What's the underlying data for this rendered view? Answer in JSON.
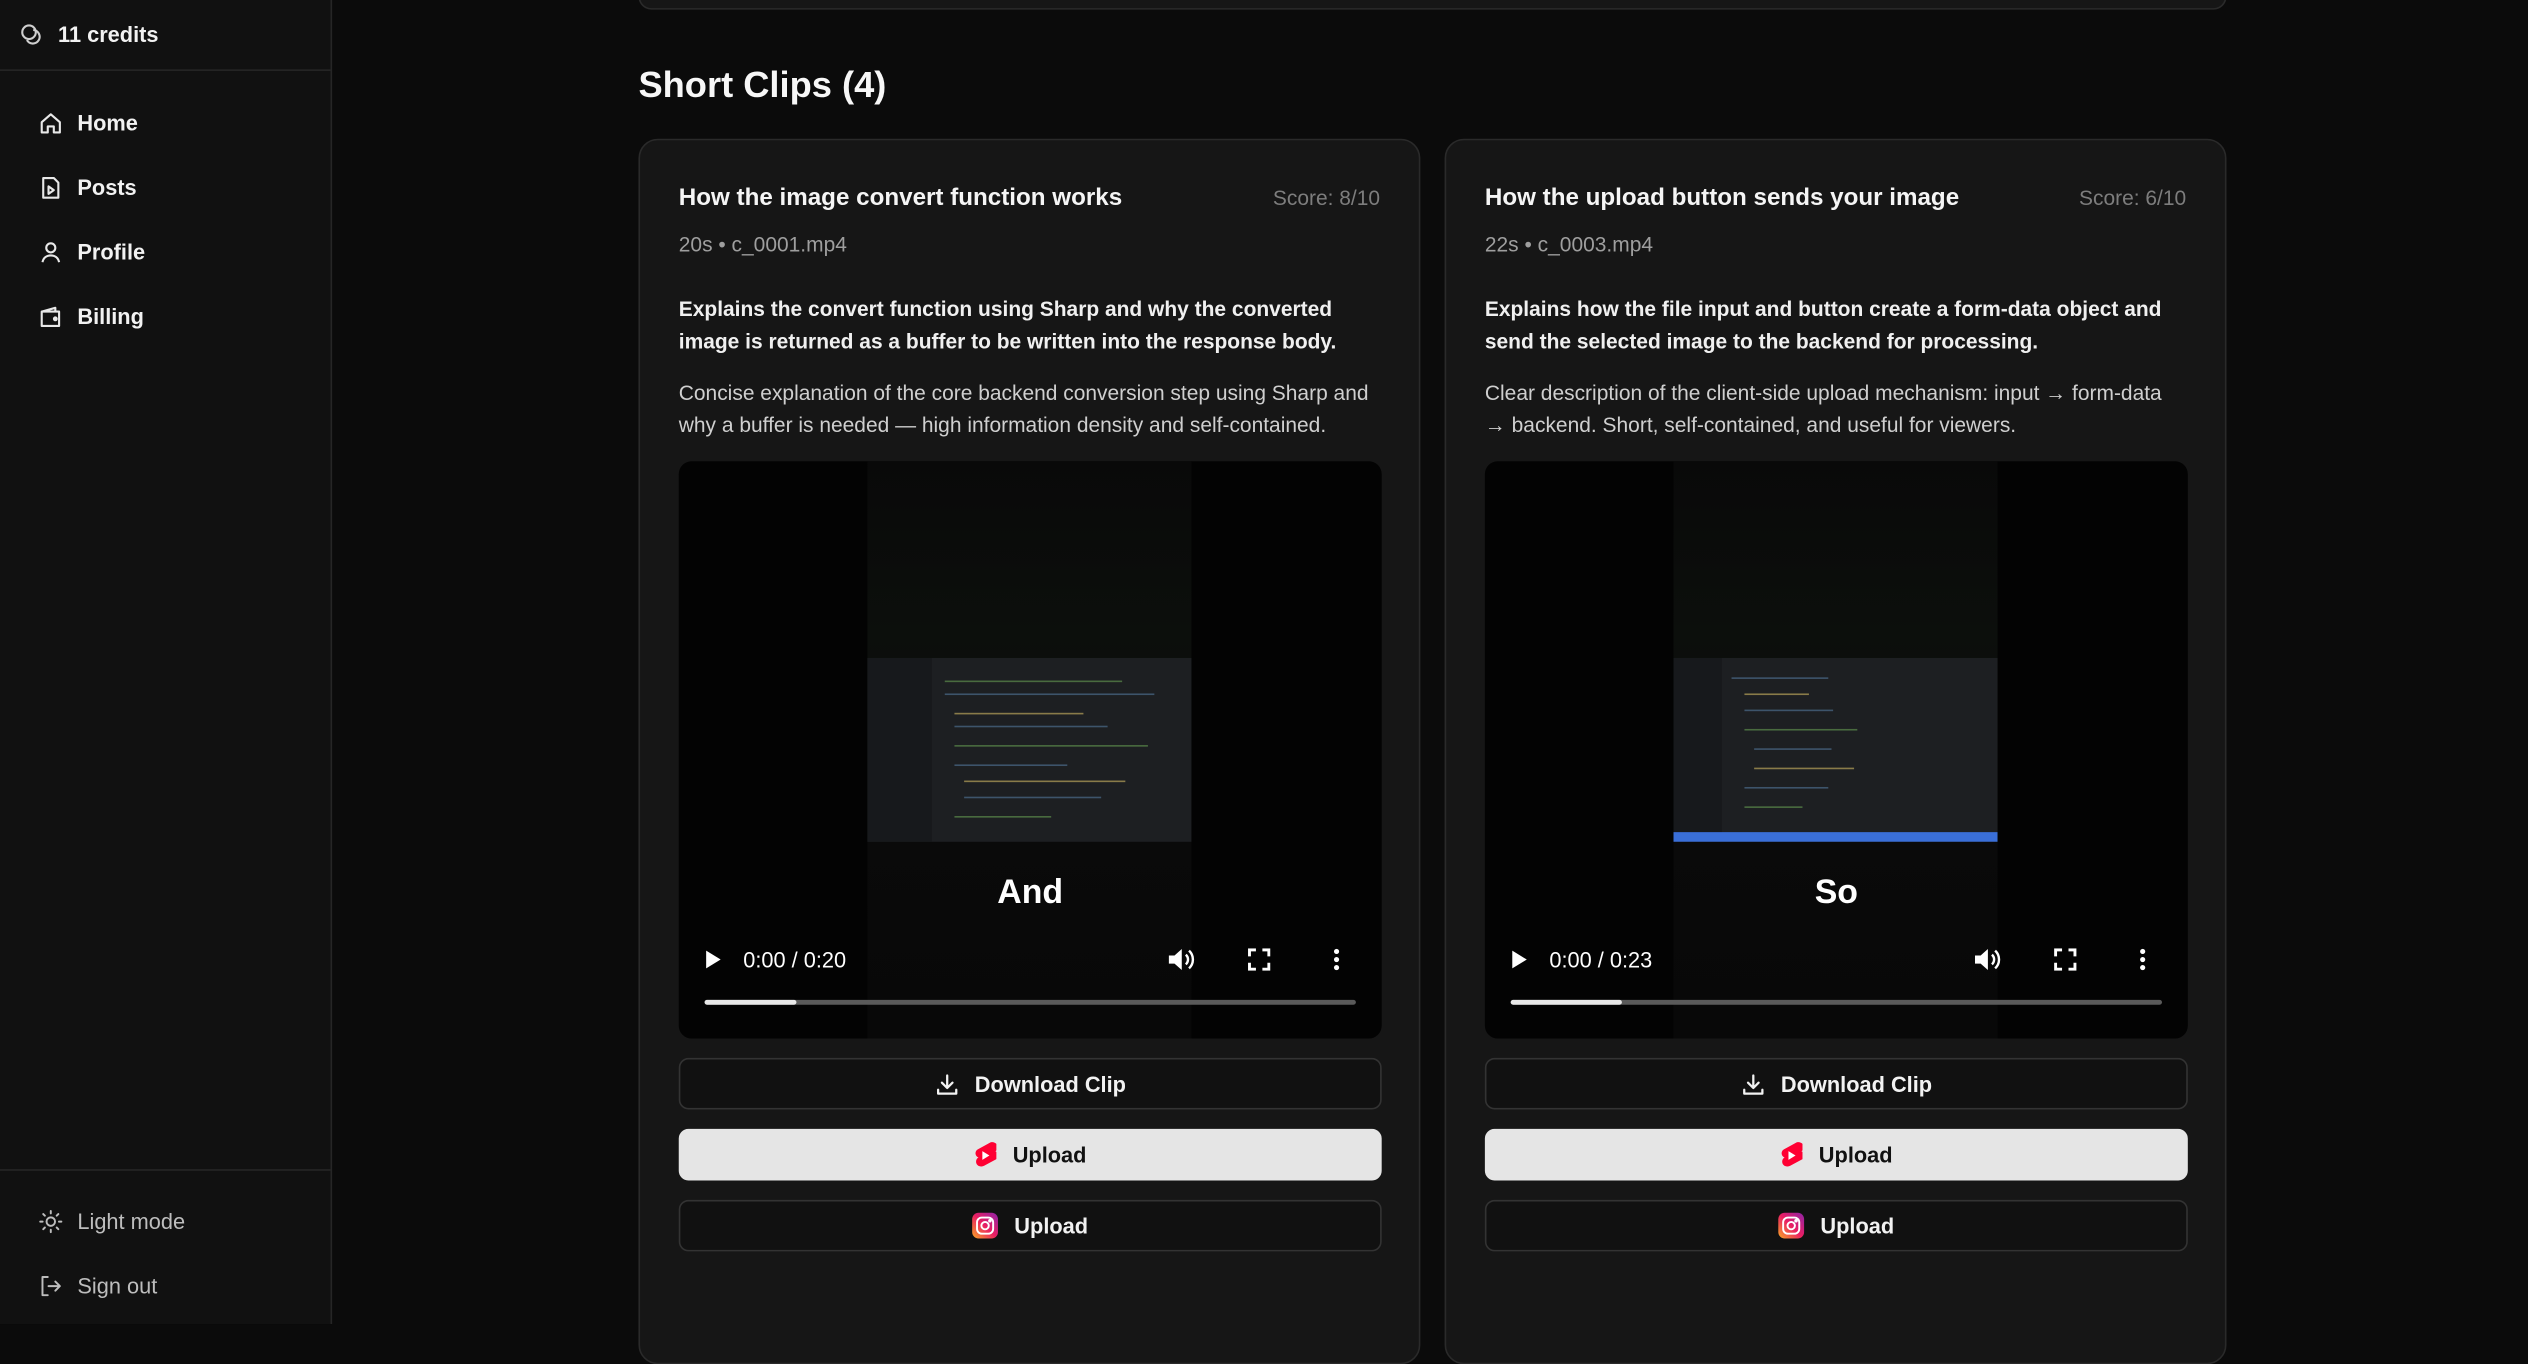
{
  "sidebar": {
    "credits": "11 credits",
    "nav": [
      {
        "label": "Home",
        "icon": "home-icon"
      },
      {
        "label": "Posts",
        "icon": "posts-icon"
      },
      {
        "label": "Profile",
        "icon": "user-icon"
      },
      {
        "label": "Billing",
        "icon": "wallet-icon"
      }
    ],
    "theme_toggle": "Light mode",
    "sign_out": "Sign out"
  },
  "main": {
    "section_title": "Short Clips (4)",
    "clips": [
      {
        "title": "How the image convert function works",
        "score": "Score: 8/10",
        "meta": "20s • c_0001.mp4",
        "summary": "Explains the convert function using Sharp and why the converted image is returned as a buffer to be written into the response body.",
        "reason": "Concise explanation of the core backend conversion step using Sharp and why a buffer is needed — high information density and self-contained.",
        "video": {
          "caption": "And",
          "time": "0:00 / 0:20",
          "progress": 0.14
        },
        "download_label": "Download Clip",
        "upload_youtube_label": "Upload",
        "upload_instagram_label": "Upload"
      },
      {
        "title": "How the upload button sends your image",
        "score": "Score: 6/10",
        "meta": "22s • c_0003.mp4",
        "summary": "Explains how the file input and button create a form-data object and send the selected image to the backend for processing.",
        "reason": "Clear description of the client-side upload mechanism: input → form-data → backend. Short, self-contained, and useful for viewers.",
        "video": {
          "caption": "So",
          "time": "0:00 / 0:23",
          "progress": 0.17
        },
        "download_label": "Download Clip",
        "upload_youtube_label": "Upload",
        "upload_instagram_label": "Upload"
      }
    ]
  },
  "colors": {
    "background": "#0b0b0b",
    "card": "#161616",
    "youtube_red": "#ff0033",
    "light_button": "#e5e5e5"
  }
}
